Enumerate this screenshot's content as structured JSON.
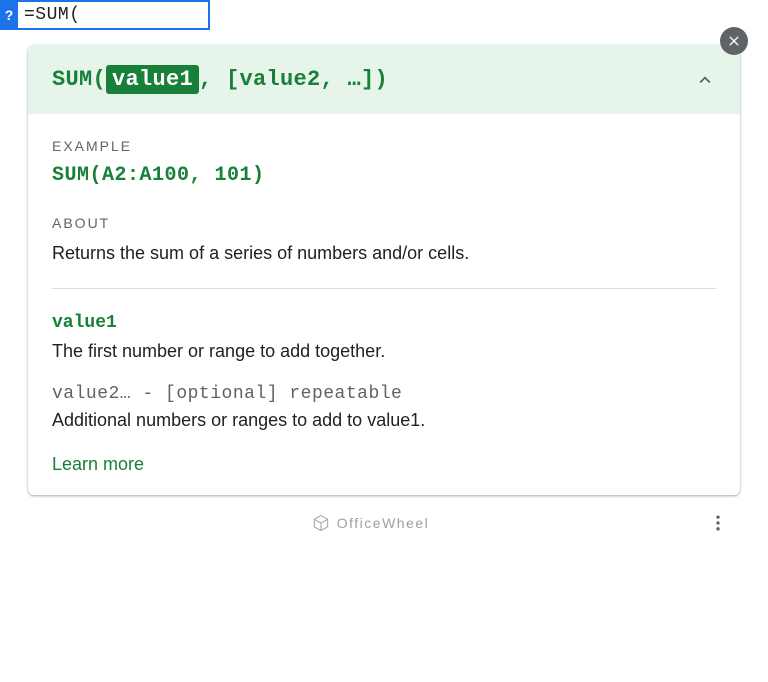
{
  "formula": {
    "input_value": "=SUM("
  },
  "tooltip": {
    "signature": {
      "func_open": "SUM(",
      "param_active": "value1",
      "rest": ", [value2, …])"
    },
    "example": {
      "label": "EXAMPLE",
      "code": "SUM(A2:A100, 101)"
    },
    "about": {
      "label": "ABOUT",
      "text": "Returns the sum of a series of numbers and/or cells."
    },
    "params": {
      "p1_name": "value1",
      "p1_desc": "The first number or range to add together.",
      "p2_name": "value2… - [optional] repeatable",
      "p2_desc": "Additional numbers or ranges to add to value1."
    },
    "learn_more": "Learn more"
  },
  "footer": {
    "watermark": "OfficeWheel"
  }
}
